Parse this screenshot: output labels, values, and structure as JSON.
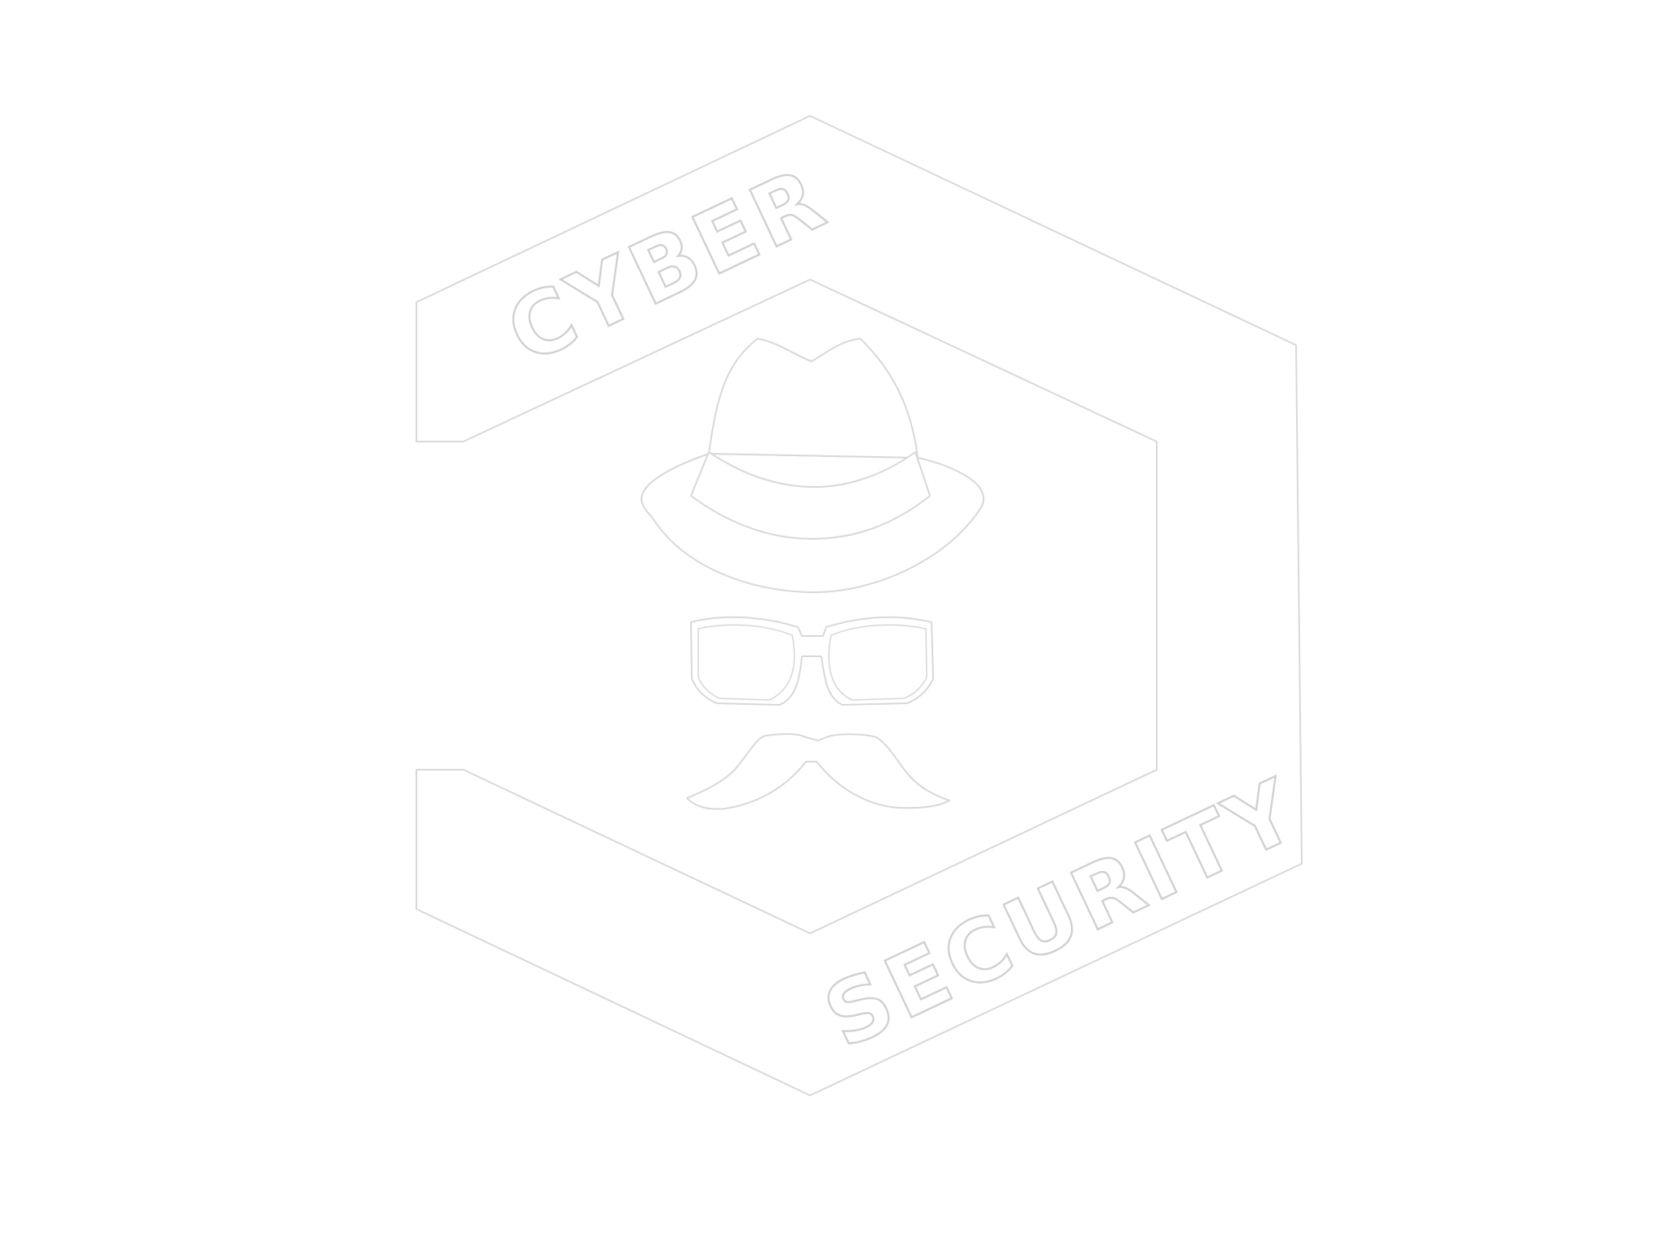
{
  "logo": {
    "top_text": "CYBER",
    "bottom_text": "SECURITY",
    "icon_name": "spy-icon"
  },
  "colors": {
    "background": "#ffffff",
    "outline": "#d8d8d8"
  }
}
